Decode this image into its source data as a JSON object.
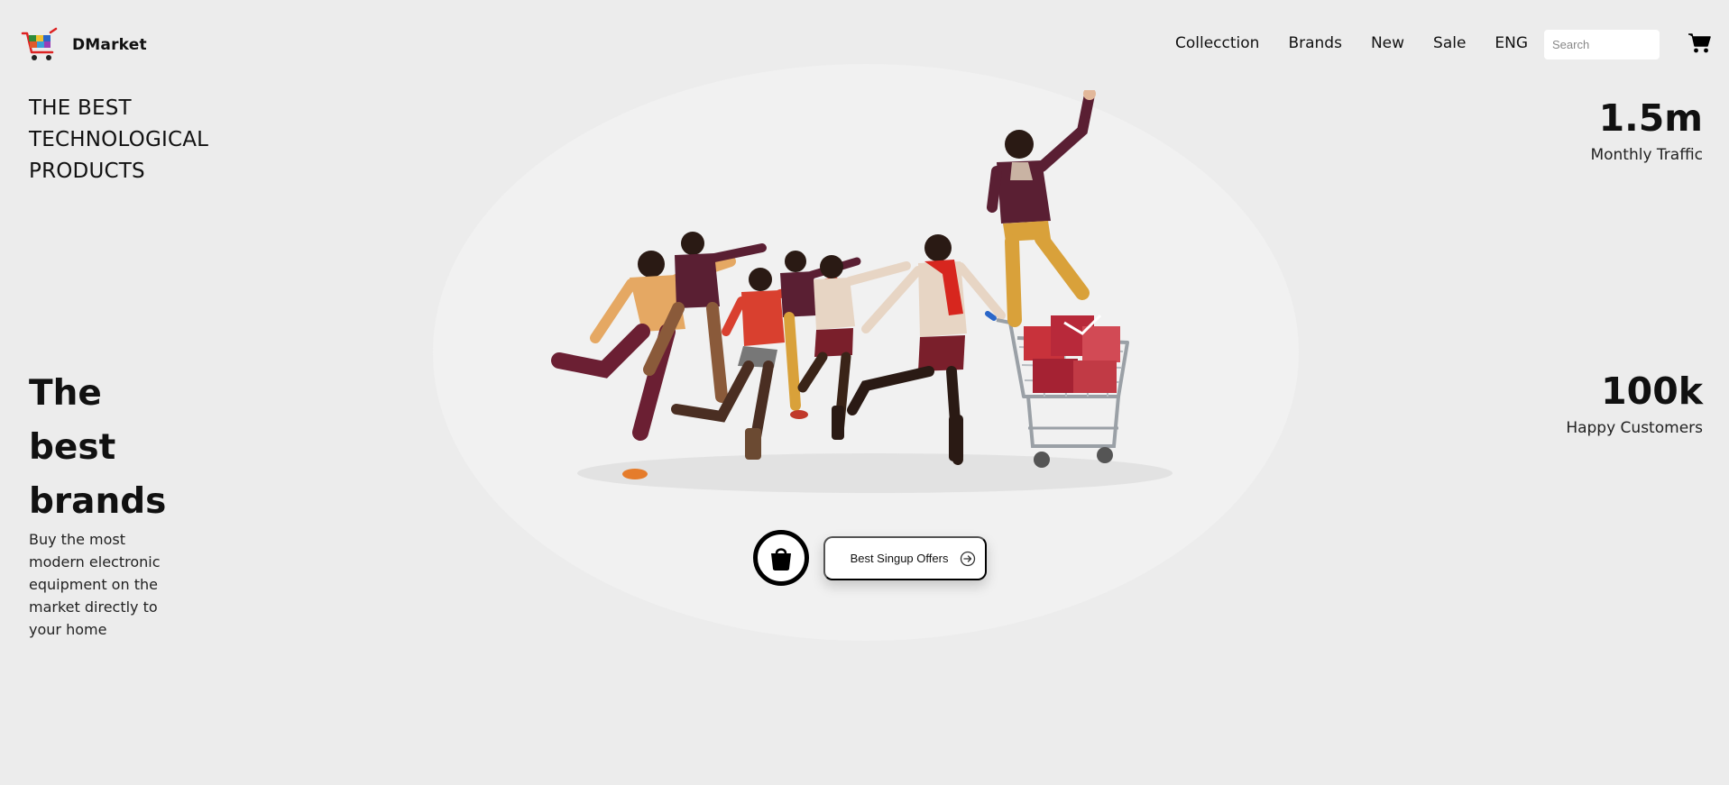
{
  "header": {
    "brand_name": "DMarket",
    "logo_icon": "shopping-cart-logo-icon",
    "nav": [
      "Collecction",
      "Brands",
      "New",
      "Sale",
      "ENG"
    ],
    "search_placeholder": "Search",
    "cart_icon": "cart-icon"
  },
  "hero": {
    "tagline": "THE BEST TECHNOLOGICAL PRODUCTS",
    "headline": "The best brands",
    "description": "Buy the most modern electronic equipment on the market directly to your home",
    "image": "group-of-shoppers-running-with-shopping-cart",
    "bag_icon": "shopping-bag-icon",
    "offer_label": "Best Singup Offers",
    "offer_icon": "arrow-right-circle-icon"
  },
  "stats": [
    {
      "value": "1.5m",
      "label": "Monthly Traffic"
    },
    {
      "value": "100k",
      "label": "Happy Customers"
    }
  ],
  "colors": {
    "background": "#ececec",
    "hero_ellipse": "#f1f1f1",
    "text": "#111111",
    "shirt_maroon": "#5a1f33",
    "accent_red": "#d9402f",
    "accent_mustard": "#d9a13a"
  }
}
